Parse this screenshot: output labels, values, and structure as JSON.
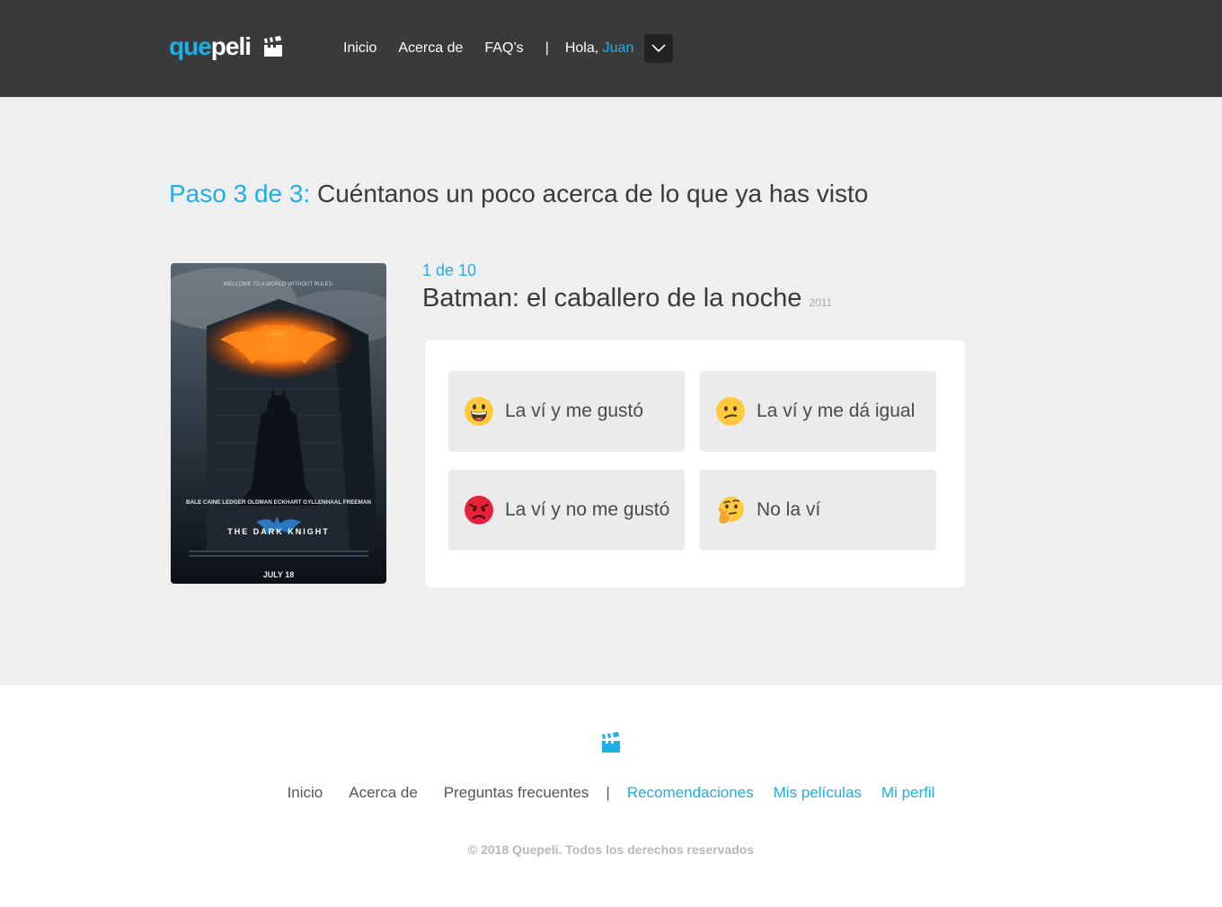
{
  "header": {
    "logo": {
      "part1": "que",
      "part2": "peli"
    },
    "nav": [
      "Inicio",
      "Acerca de",
      "FAQ’s"
    ],
    "separator": "|",
    "greeting": "Hola,",
    "user_name": "Juan"
  },
  "main": {
    "step_label": "Paso 3 de 3:",
    "step_text": "Cuéntanos un poco acerca de lo que ya has visto",
    "counter": "1 de 10",
    "movie_title": "Batman: el caballero de la noche",
    "movie_year": "2011",
    "poster": {
      "top_text": "WELCOME TO A WORLD WITHOUT RULES.",
      "cast": "BALE  CAINE  LEDGER  OLDMAN  ECKHART  GYLLENHAAL  FREEMAN",
      "title": "THE DARK KNIGHT",
      "date": "JULY 18"
    },
    "options": [
      {
        "label": "La ví y me gustó",
        "icon": "grinning-face-icon"
      },
      {
        "label": "La ví y me dá igual",
        "icon": "confused-face-icon"
      },
      {
        "label": "La ví y no me gustó",
        "icon": "angry-face-icon"
      },
      {
        "label": "No la ví",
        "icon": "thinking-face-icon"
      }
    ]
  },
  "footer": {
    "nav_gray": [
      "Inicio",
      "Acerca de",
      "Preguntas frecuentes"
    ],
    "separator": "|",
    "nav_blue": [
      "Recomendaciones",
      "Mis películas",
      "Mi perfil"
    ],
    "copyright": "© 2018 Quepeli. Todos los derechos reservados"
  },
  "colors": {
    "accent": "#1eaee8",
    "header_bg": "#3a3a3a",
    "main_bg": "#efefef"
  }
}
